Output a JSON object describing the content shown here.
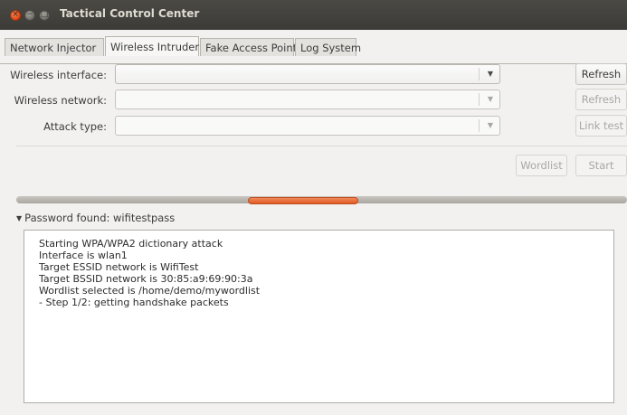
{
  "window": {
    "title": "Tactical Control Center",
    "controls": {
      "close": "×",
      "minimize": "−",
      "maximize": "□"
    }
  },
  "tabs": [
    {
      "label": "Network Injector",
      "active": false
    },
    {
      "label": "Wireless Intruder",
      "active": true
    },
    {
      "label": "Fake Access Point",
      "active": false
    },
    {
      "label": "Log System",
      "active": false
    }
  ],
  "form": {
    "interface_label": "Wireless interface:",
    "interface_value": "",
    "network_label": "Wireless network:",
    "network_value": "",
    "attack_label": "Attack type:",
    "attack_value": "",
    "dropdown_arrow": "▼"
  },
  "buttons": {
    "refresh_interface": "Refresh",
    "refresh_network": "Refresh",
    "link_test": "Link test",
    "wordlist": "Wordlist",
    "start": "Start"
  },
  "result": {
    "expander_arrow": "▼",
    "label": "Password found: wifitestpass"
  },
  "log": [
    "Starting WPA/WPA2 dictionary attack",
    "Interface is wlan1",
    "Target ESSID network is WifiTest",
    "Target BSSID network is 30:85:a9:69:90:3a",
    "Wordlist selected is /home/demo/mywordlist",
    "- Step 1/2: getting handshake packets"
  ],
  "colors": {
    "titlebar": "#3c3b37",
    "window_bg": "#f2f1f0",
    "accent": "#e05a23"
  }
}
